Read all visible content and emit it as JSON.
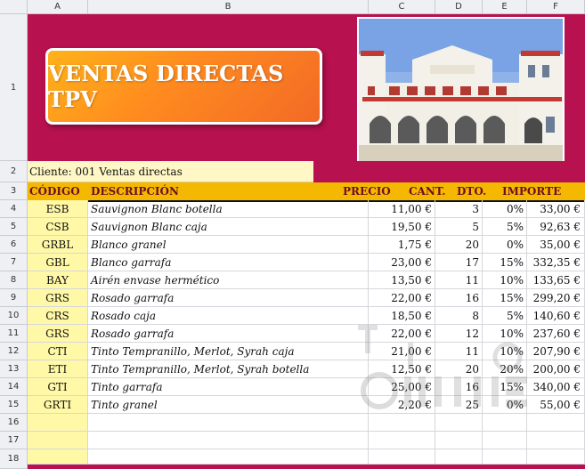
{
  "columns": [
    "A",
    "B",
    "C",
    "D",
    "E",
    "F"
  ],
  "rows": [
    "1",
    "2",
    "3",
    "4",
    "5",
    "6",
    "7",
    "8",
    "9",
    "10",
    "11",
    "12",
    "13",
    "14",
    "15",
    "16",
    "17",
    "18"
  ],
  "title": "VENTAS DIRECTAS TPV",
  "client": "Cliente: 001 Ventas directas",
  "header": {
    "codigo": "CÓDIGO",
    "descripcion": "DESCRIPCIÓN",
    "precio": "PRECIO",
    "cant": "CANT.",
    "dto": "DTO.",
    "importe": "IMPORTE"
  },
  "items": [
    {
      "codigo": "ESB",
      "descripcion": "Sauvignon Blanc botella",
      "precio": "11,00 €",
      "cant": "3",
      "dto": "0%",
      "importe": "33,00 €"
    },
    {
      "codigo": "CSB",
      "descripcion": "Sauvignon Blanc caja",
      "precio": "19,50 €",
      "cant": "5",
      "dto": "5%",
      "importe": "92,63 €"
    },
    {
      "codigo": "GRBL",
      "descripcion": "Blanco granel",
      "precio": "1,75 €",
      "cant": "20",
      "dto": "0%",
      "importe": "35,00 €"
    },
    {
      "codigo": "GBL",
      "descripcion": "Blanco garrafa",
      "precio": "23,00 €",
      "cant": "17",
      "dto": "15%",
      "importe": "332,35 €"
    },
    {
      "codigo": "BAY",
      "descripcion": "Airén envase hermético",
      "precio": "13,50 €",
      "cant": "11",
      "dto": "10%",
      "importe": "133,65 €"
    },
    {
      "codigo": "GRS",
      "descripcion": "Rosado garrafa",
      "precio": "22,00 €",
      "cant": "16",
      "dto": "15%",
      "importe": "299,20 €"
    },
    {
      "codigo": "CRS",
      "descripcion": "Rosado caja",
      "precio": "18,50 €",
      "cant": "8",
      "dto": "5%",
      "importe": "140,60 €"
    },
    {
      "codigo": "GRS",
      "descripcion": "Rosado garrafa",
      "precio": "22,00 €",
      "cant": "12",
      "dto": "10%",
      "importe": "237,60 €"
    },
    {
      "codigo": "CTI",
      "descripcion": "Tinto Tempranillo, Merlot, Syrah caja",
      "precio": "21,00 €",
      "cant": "11",
      "dto": "10%",
      "importe": "207,90 €"
    },
    {
      "codigo": "ETI",
      "descripcion": "Tinto Tempranillo, Merlot, Syrah botella",
      "precio": "12,50 €",
      "cant": "20",
      "dto": "20%",
      "importe": "200,00 €"
    },
    {
      "codigo": "GTI",
      "descripcion": "Tinto garrafa",
      "precio": "25,00 €",
      "cant": "16",
      "dto": "15%",
      "importe": "340,00 €"
    },
    {
      "codigo": "GRTI",
      "descripcion": "Tinto granel",
      "precio": "2,20 €",
      "cant": "25",
      "dto": "0%",
      "importe": "55,00 €"
    }
  ],
  "colors": {
    "banner": "#b8114f",
    "header": "#f5b800",
    "code_column": "#fff8a6",
    "title_box": "#ff8a1f"
  }
}
